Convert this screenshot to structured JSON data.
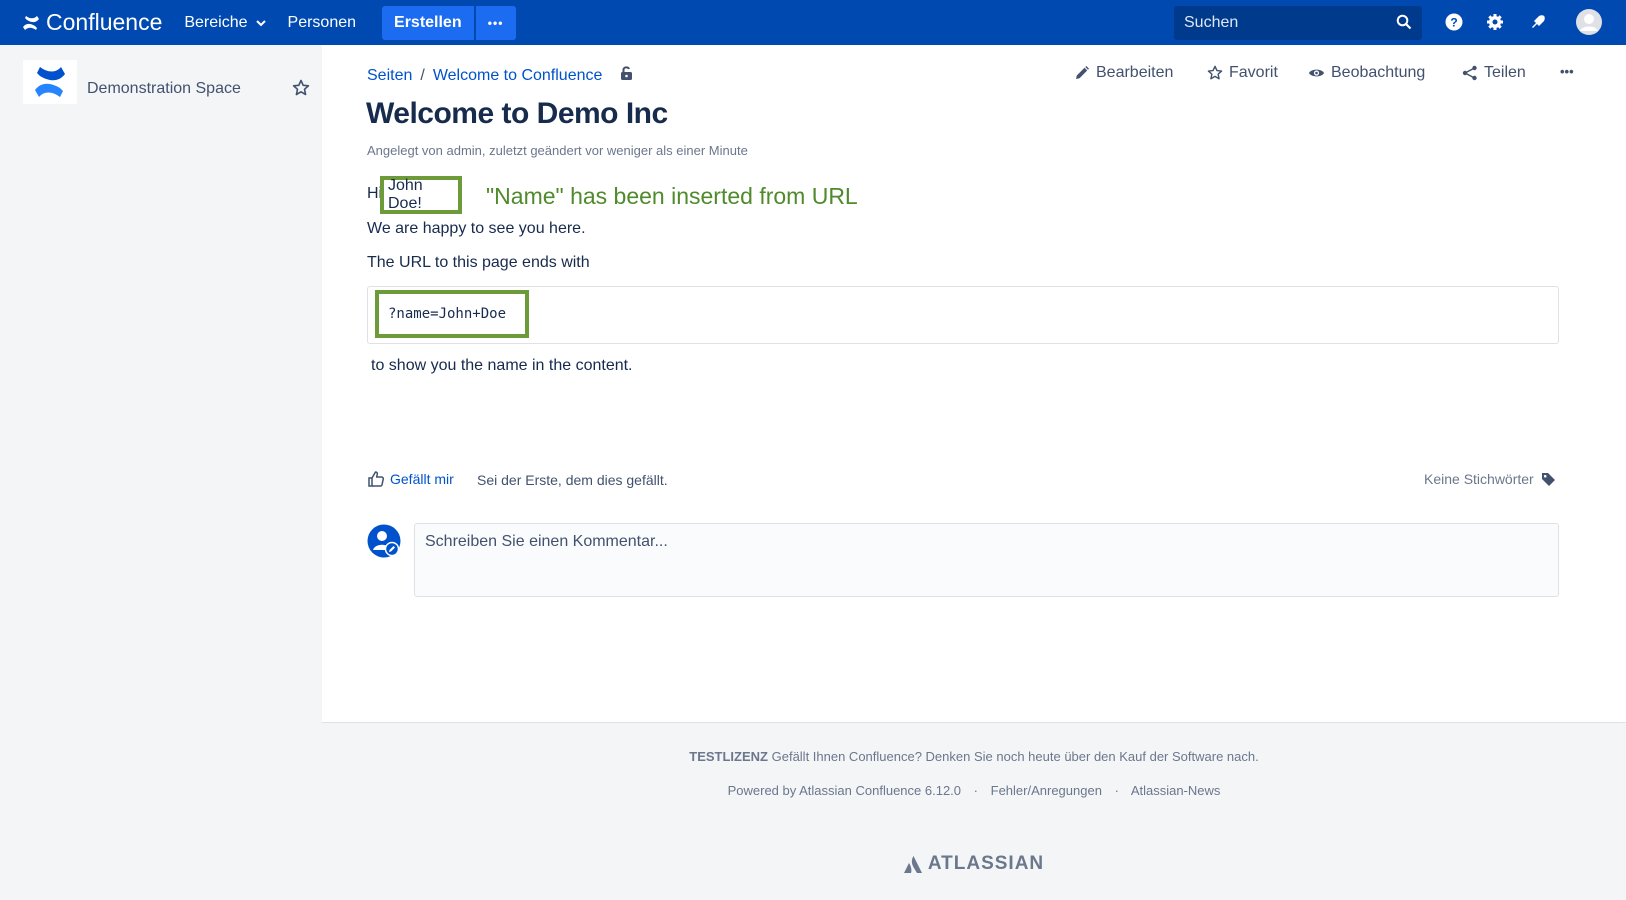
{
  "topbar": {
    "brand": "Confluence",
    "nav": [
      "Bereiche",
      "Personen"
    ],
    "create_label": "Erstellen",
    "more_label": "•••",
    "search_placeholder": "Suchen",
    "icons": [
      "help-icon",
      "gear-icon",
      "notification-icon",
      "user-avatar-icon"
    ]
  },
  "sidebar": {
    "space_name": "Demonstration Space"
  },
  "breadcrumb": {
    "items": [
      "Seiten",
      "Welcome to Confluence"
    ],
    "separator": "/"
  },
  "actions": {
    "edit_label": "Bearbeiten",
    "favorite_label": "Favorit",
    "watch_label": "Beobachtung",
    "share_label": "Teilen",
    "more_label": "•••"
  },
  "page": {
    "title": "Welcome to Demo Inc",
    "byline": "Angelegt von admin, zuletzt geändert vor weniger als einer Minute",
    "hi_prefix": "Hi",
    "name_value": "John Doe!",
    "annotation": "\"Name\" has been inserted from URL",
    "para1": "We are happy to see you here.",
    "para2": "The URL to this page ends with",
    "code": "?name=John+Doe",
    "para3": "to show you the name in the content."
  },
  "social": {
    "like_label": "Gefällt mir",
    "like_text": "Sei der Erste, dem dies gefällt.",
    "labels_text": "Keine Stichwörter"
  },
  "comment": {
    "placeholder": "Schreiben Sie einen Kommentar..."
  },
  "footer": {
    "license_strong": "TESTLIZENZ",
    "license_text": "Gefällt Ihnen Confluence? Denken Sie noch heute über den Kauf der Software nach.",
    "powered": "Powered by Atlassian Confluence 6.12.0",
    "feedback": "Fehler/Anregungen",
    "news": "Atlassian-News",
    "dot": "·",
    "atlassian": "ATLASSIAN"
  },
  "colors": {
    "topbar": "#0049b0",
    "create": "#1c6cf2",
    "highlight": "#6d9b3a",
    "annotation": "#4f8a2b",
    "link": "#0052cc"
  }
}
